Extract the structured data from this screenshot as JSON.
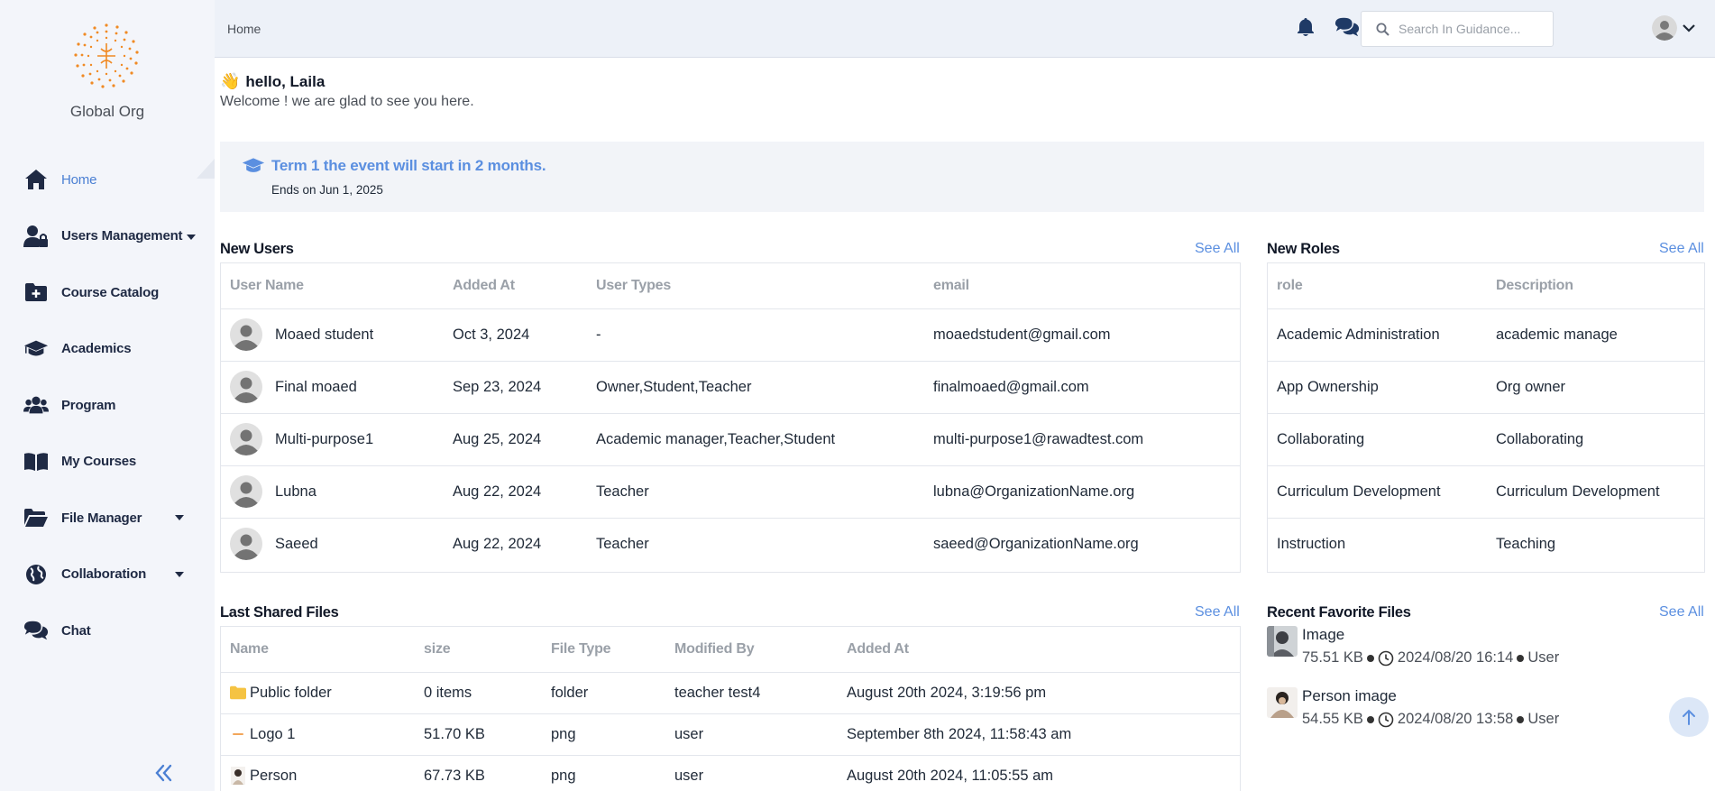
{
  "sidebar": {
    "org_name": "Global Org",
    "items": [
      {
        "label": "Home",
        "icon": "home-icon"
      },
      {
        "label": "Users Management",
        "icon": "user-lock-icon"
      },
      {
        "label": "Course Catalog",
        "icon": "folder-plus-icon"
      },
      {
        "label": "Academics",
        "icon": "graduation-cap-icon"
      },
      {
        "label": "Program",
        "icon": "users-icon"
      },
      {
        "label": "My Courses",
        "icon": "book-open-icon"
      },
      {
        "label": "File Manager",
        "icon": "folder-open-icon"
      },
      {
        "label": "Collaboration",
        "icon": "globe-icon"
      },
      {
        "label": "Chat",
        "icon": "comments-icon"
      }
    ]
  },
  "header": {
    "breadcrumb": "Home",
    "search_placeholder": "Search In Guidance..."
  },
  "greeting": {
    "title": "hello, Laila",
    "subtitle": "Welcome ! we are glad to see you here."
  },
  "event": {
    "title": "Term 1 the event will start in 2 months.",
    "ends": "Ends on Jun 1, 2025"
  },
  "new_users": {
    "title": "New Users",
    "see_all": "See All",
    "columns": [
      "User Name",
      "Added At",
      "User Types",
      "email"
    ],
    "rows": [
      {
        "name": "Moaed student",
        "added": "Oct 3, 2024",
        "types": "-",
        "email": "moaedstudent@gmail.com"
      },
      {
        "name": "Final moaed",
        "added": "Sep 23, 2024",
        "types": "Owner,Student,Teacher",
        "email": "finalmoaed@gmail.com"
      },
      {
        "name": "Multi-purpose1",
        "added": "Aug 25, 2024",
        "types": "Academic manager,Teacher,Student",
        "email": "multi-purpose1@rawadtest.com"
      },
      {
        "name": "Lubna",
        "added": "Aug 22, 2024",
        "types": "Teacher",
        "email": "lubna@OrganizationName.org"
      },
      {
        "name": "Saeed",
        "added": "Aug 22, 2024",
        "types": "Teacher",
        "email": "saeed@OrganizationName.org"
      }
    ]
  },
  "new_roles": {
    "title": "New Roles",
    "see_all": "See All",
    "columns": [
      "role",
      "Description"
    ],
    "rows": [
      {
        "role": "Academic Administration",
        "desc": "academic manage"
      },
      {
        "role": "App Ownership",
        "desc": "Org owner"
      },
      {
        "role": "Collaborating",
        "desc": "Collaborating"
      },
      {
        "role": "Curriculum Development",
        "desc": "Curriculum Development"
      },
      {
        "role": "Instruction",
        "desc": "Teaching"
      }
    ]
  },
  "shared_files": {
    "title": "Last Shared Files",
    "see_all": "See All",
    "columns": [
      "Name",
      "size",
      "File Type",
      "Modified By",
      "Added At"
    ],
    "rows": [
      {
        "name": "Public folder",
        "size": "0 items",
        "type": "folder",
        "by": "teacher test4",
        "added": "August 20th 2024, 3:19:56 pm",
        "icon": "folder-icon"
      },
      {
        "name": "Logo 1",
        "size": "51.70 KB",
        "type": "png",
        "by": "user",
        "added": "September 8th 2024, 11:58:43 am",
        "icon": "logo-thumbnail-icon"
      },
      {
        "name": "Person",
        "size": "67.73 KB",
        "type": "png",
        "by": "user",
        "added": "August 20th 2024, 11:05:55 am",
        "icon": "person-thumbnail-icon"
      }
    ]
  },
  "favorites": {
    "title": "Recent Favorite Files",
    "see_all": "See All",
    "items": [
      {
        "name": "Image",
        "size": "75.51 KB",
        "date": "2024/08/20 16:14",
        "owner": "User"
      },
      {
        "name": "Person image",
        "size": "54.55 KB",
        "date": "2024/08/20 13:58",
        "owner": "User"
      }
    ]
  },
  "colors": {
    "accent": "#5b8fe0",
    "nav_text": "#1f2a44",
    "sidebar_bg": "#f3f5fa",
    "logo": "#f08a24"
  }
}
